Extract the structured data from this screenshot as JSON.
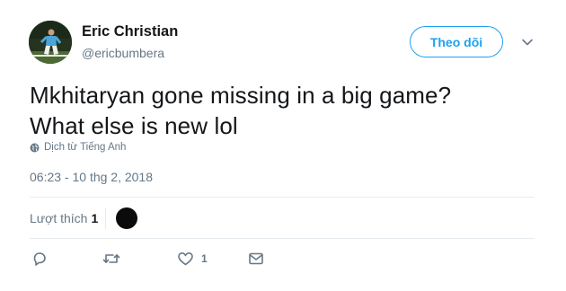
{
  "user": {
    "display_name": "Eric Christian",
    "handle": "@ericbumbera",
    "avatar_icon": "profile-photo"
  },
  "follow_button": {
    "label": "Theo dõi",
    "color": "#1da1f2"
  },
  "tweet": {
    "text_line1": "Mkhitaryan gone missing in a big game?",
    "text_line2": "What else is new lol",
    "translate_label": "Dịch từ Tiếng Anh",
    "translate_icon": "globe-icon",
    "timestamp": "06:23 - 10 thg 2, 2018"
  },
  "likes": {
    "label": "Lượt thích",
    "count": "1"
  },
  "actions": {
    "reply_icon": "reply-icon",
    "retweet_icon": "retweet-icon",
    "like_icon": "heart-icon",
    "like_count": "1",
    "dm_icon": "envelope-icon"
  },
  "colors": {
    "text_primary": "#14171a",
    "text_secondary": "#657786",
    "divider": "#e6ecf0"
  }
}
